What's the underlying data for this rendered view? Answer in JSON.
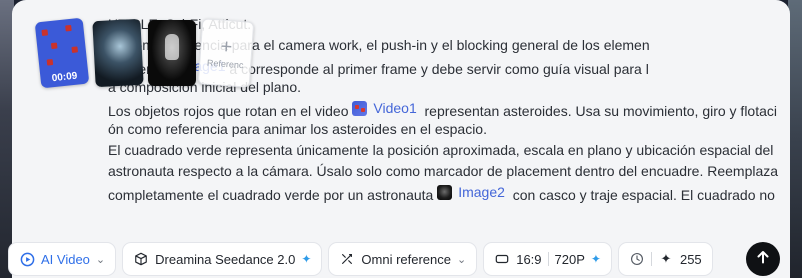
{
  "attachments": {
    "video_duration": "00:09",
    "add_label": "Referenc"
  },
  "prompt_lines": [
    {
      "segments": [
        {
          "text": "UTICLE: Sci-Fi, Atticut."
        }
      ]
    },
    {
      "segments": [
        {
          "text": "",
          "ref": null
        },
        {
          "text": "o1 como referencia para el camera work, el push-in y el blocking general de los elemen"
        }
      ]
    },
    {
      "segments": [
        {
          "text": "imagen "
        },
        {
          "text": "Image1",
          "ref": "image1"
        },
        {
          "text": " a corresponde al primer frame y debe servir como guía visual para l"
        }
      ]
    },
    {
      "segments": [
        {
          "text": "a composición inicial del plano."
        }
      ]
    },
    {
      "segments": [
        {
          "text": "Los objetos rojos que rotan en el video "
        },
        {
          "text": "Video1",
          "ref": "video1"
        },
        {
          "text": "  representan asteroides. Usa su movimiento, giro y flotaci"
        }
      ]
    },
    {
      "segments": [
        {
          "text": "ón como referencia para animar los asteroides en el espacio."
        }
      ]
    },
    {
      "segments": [
        {
          "text": "El cuadrado verde representa únicamente la posición aproximada, escala en plano y ubicación espacial del"
        }
      ]
    },
    {
      "segments": [
        {
          "text": "astronauta respecto a la cámara. Úsalo solo como marcador de placement dentro del encuadre. Reemplaza"
        }
      ]
    },
    {
      "segments": [
        {
          "text": "completamente el cuadrado verde por un astronauta "
        },
        {
          "text": "Image2",
          "ref": "image2"
        },
        {
          "text": "  con casco y traje espacial. El cuadrado no"
        }
      ]
    }
  ],
  "toolbar": {
    "mode_label": "AI Video",
    "model_label": "Dreamina Seedance 2.0",
    "reference_label": "Omni reference",
    "ratio_label": "16:9",
    "resolution_label": "720P",
    "credits_value": "255"
  },
  "icons": {
    "mode": "play-circle-icon",
    "model": "cube-icon",
    "reference": "omni-reference-icon",
    "ratio": "aspect-ratio-icon",
    "duration": "clock-icon",
    "credits": "sparkle-icon",
    "send": "arrow-up-icon"
  },
  "colors": {
    "accent": "#2f6fe8",
    "reference_link": "#4466d8",
    "send_button": "#0f1114"
  }
}
